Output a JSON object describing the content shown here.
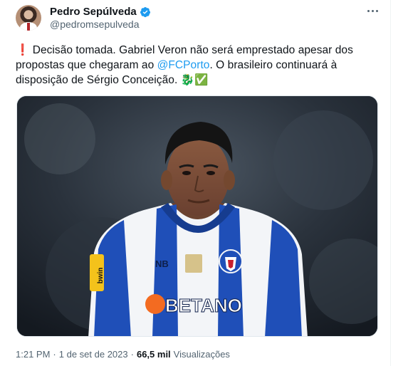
{
  "author": {
    "display_name": "Pedro Sepúlveda",
    "handle": "@pedromsepulveda",
    "verified": true
  },
  "tweet": {
    "exclaim_emoji": "❗",
    "text_part1": " Decisão tomada. Gabriel Veron não será emprestado apesar dos propostas que chegaram ao ",
    "mention": "@FCPorto",
    "text_part2": ". O brasileiro continuará à disposição de Sérgio Conceição. ",
    "trailing_emojis": "🐉✅"
  },
  "media": {
    "jersey_sponsor": "BETANO",
    "jersey_brand": "NB",
    "sleeve_patch": "bwin"
  },
  "meta": {
    "time": "1:21 PM",
    "separator1": "·",
    "date": "1 de set de 2023",
    "separator2": "·",
    "views_count": "66,5 mil",
    "views_label": "Visualizações"
  },
  "colors": {
    "accent": "#1d9bf0",
    "text_primary": "#0f1419",
    "text_secondary": "#536471",
    "jersey_blue": "#1f4fb8"
  }
}
